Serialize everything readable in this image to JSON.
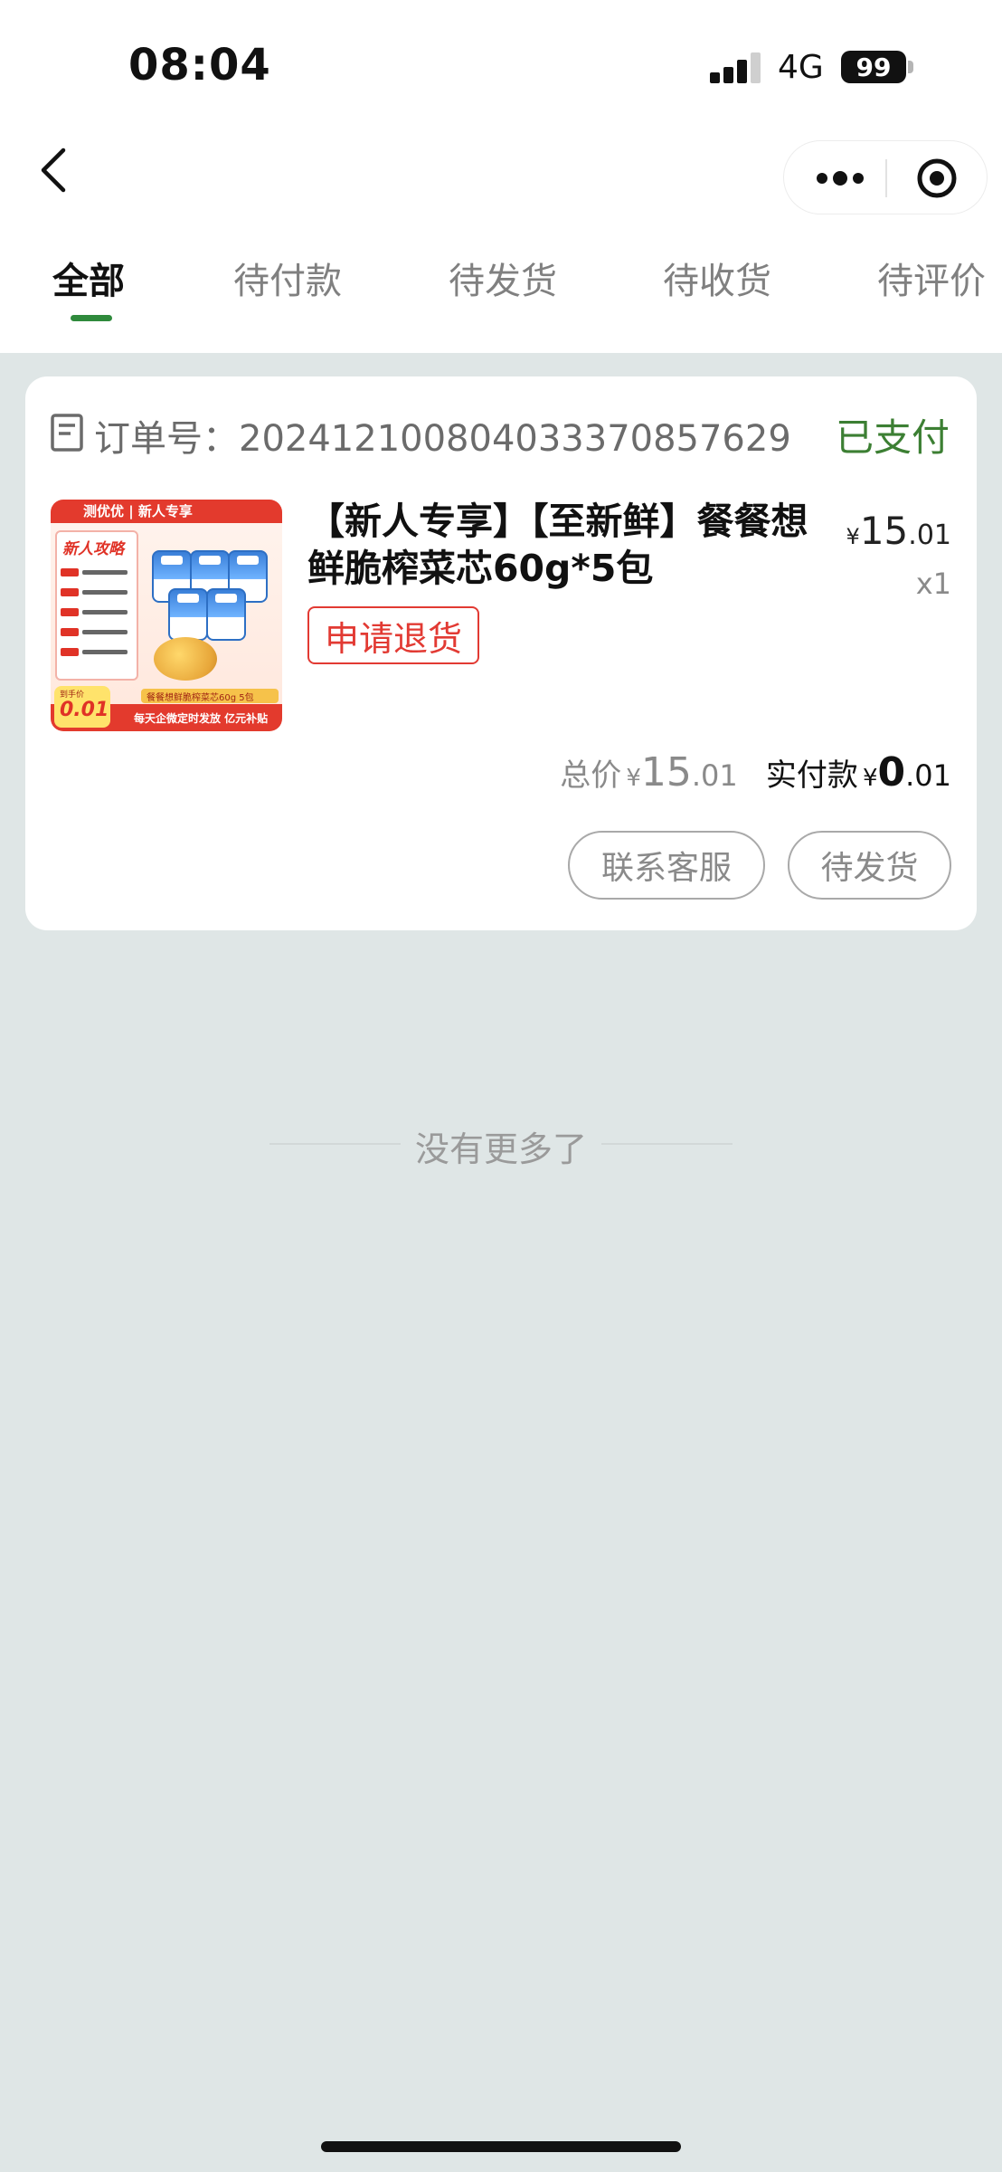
{
  "status_bar": {
    "time": "08:04",
    "network": "4G",
    "battery": "99"
  },
  "nav": {
    "back_icon": "chevron-left-icon",
    "more_icon": "more-dots-icon",
    "close_icon": "target-circle-icon"
  },
  "tabs": [
    {
      "label": "全部",
      "active": true
    },
    {
      "label": "待付款",
      "active": false
    },
    {
      "label": "待发货",
      "active": false
    },
    {
      "label": "待收货",
      "active": false
    },
    {
      "label": "待评价",
      "active": false
    }
  ],
  "order": {
    "order_no_label": "订单号：",
    "order_no": "20241210080403337085762​9",
    "status": "已支付",
    "status_color": "#3c7f33",
    "product": {
      "title": "【新人专享】【至新鲜】餐餐想鲜脆榨菜芯60g*5包",
      "refund_label": "申请退货",
      "currency": "¥",
      "price_int": "15",
      "price_dec": ".01",
      "qty": "x1",
      "image": {
        "top_text": "测优优 | 新人专享",
        "guide_title": "新人攻略",
        "band_text": "餐餐想鲜脆榨菜芯60g 5包",
        "bottom_text": "每天企微定时发放 亿元补贴",
        "price_label": "到手价",
        "price_value": "0.01"
      }
    },
    "total_label": "总价",
    "total_currency": "¥",
    "total_int": "15",
    "total_dec": ".01",
    "paid_label": "实付款",
    "paid_currency": "¥",
    "paid_int": "0",
    "paid_dec": ".01",
    "buttons": {
      "service": "联系客服",
      "pending": "待发货"
    }
  },
  "footer": {
    "no_more": "没有更多了"
  },
  "colors": {
    "accent_green": "#2f8a3c",
    "refund_red": "#e23a33",
    "page_bg": "#dfe6e6"
  }
}
